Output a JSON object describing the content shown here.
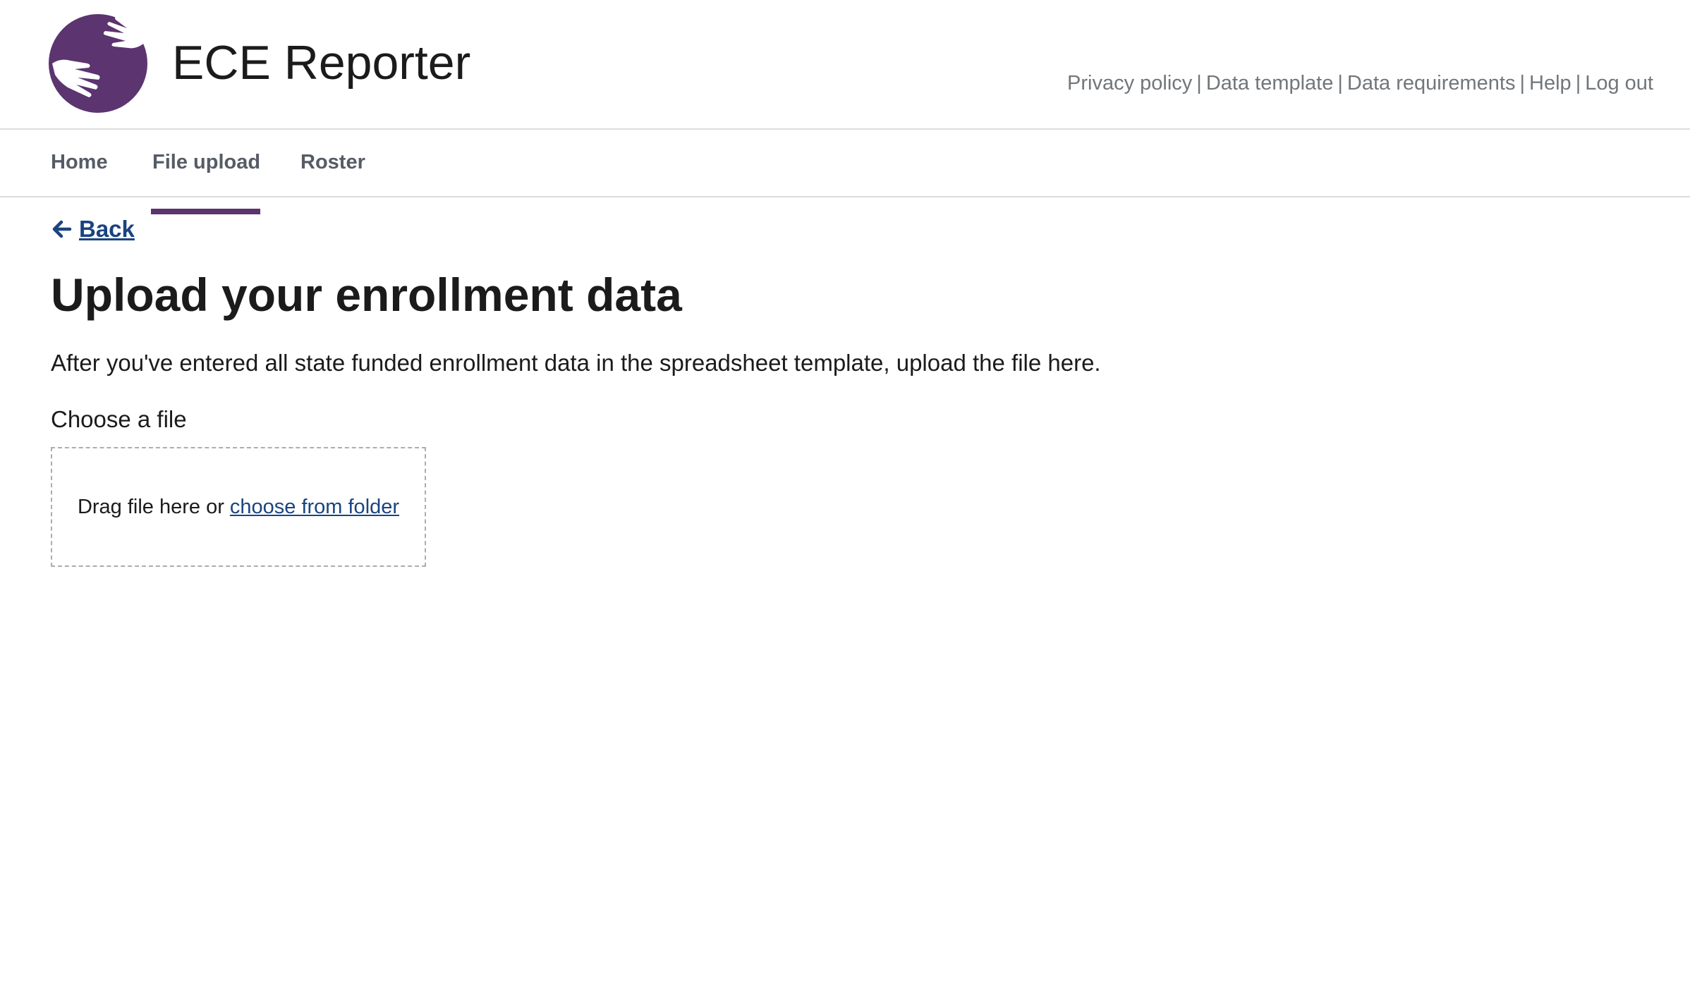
{
  "header": {
    "app_title": "ECE Reporter",
    "logo_icon": "hands-logo-icon",
    "brand_color": "#5b3470",
    "util_links": [
      {
        "label": "Privacy policy"
      },
      {
        "label": "Data template"
      },
      {
        "label": "Data requirements"
      },
      {
        "label": "Help"
      },
      {
        "label": "Log out"
      }
    ],
    "separator": "|"
  },
  "nav": {
    "items": [
      {
        "label": "Home",
        "active": false
      },
      {
        "label": "File upload",
        "active": true
      },
      {
        "label": "Roster",
        "active": false
      }
    ]
  },
  "main": {
    "back_label": "Back",
    "back_icon": "arrow-left-icon",
    "title": "Upload your enrollment data",
    "intro": "After you've entered all state funded enrollment data in the spreadsheet template, upload the file here.",
    "file_label": "Choose a file",
    "dropzone_text": "Drag file here or",
    "dropzone_link": "choose from folder"
  },
  "colors": {
    "link": "#1a4480",
    "text": "#1b1b1b",
    "muted": "#71767a"
  }
}
